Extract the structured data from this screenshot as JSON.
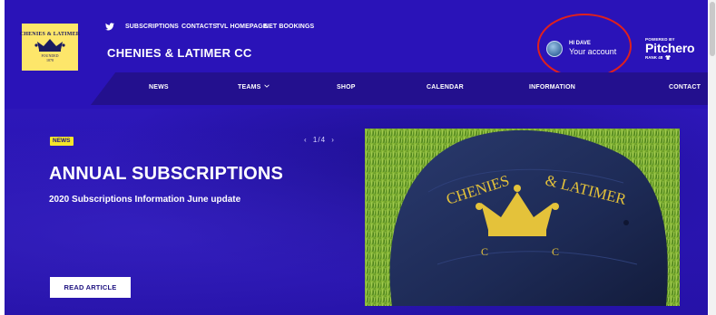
{
  "header": {
    "crest": {
      "name": "CHENIES & LATIMER",
      "founded": "FOUNDED",
      "year": "1878"
    },
    "top_links": [
      "SUBSCRIPTIONS",
      "CONTACTS",
      "TVL HOMEPAGE",
      "NET BOOKINGS"
    ],
    "club_name": "CHENIES & LATIMER CC",
    "account": {
      "greeting": "HI DAVE",
      "label": "Your account"
    },
    "pitchero": {
      "powered_by": "POWERED BY",
      "logo": "Pitchero",
      "rank": "RANK 48"
    }
  },
  "nav": {
    "items": [
      {
        "label": "NEWS"
      },
      {
        "label": "TEAMS",
        "has_dropdown": true
      },
      {
        "label": "SHOP"
      },
      {
        "label": "CALENDAR"
      },
      {
        "label": "INFORMATION"
      },
      {
        "label": "CONTACT"
      }
    ]
  },
  "hero": {
    "badge": "NEWS",
    "slider": {
      "prev": "‹",
      "position": "1/4",
      "next": "›"
    },
    "title": "ANNUAL SUBSCRIPTIONS",
    "subtitle": "2020 Subscriptions Information June update",
    "button": "READ ARTICLE",
    "photo": {
      "cap_text": "CHENIES & LATIMER",
      "cap_initials": "C  C"
    }
  },
  "colors": {
    "brand_blue": "#2a13b8",
    "nav_blue": "#23108e",
    "badge_yellow": "#f5e62a",
    "crest_yellow": "#fde66a",
    "highlight_red": "#e0201c",
    "cap_navy": "#1d2a55",
    "embroidery_gold": "#e4c23a"
  },
  "icons": {
    "social": "twitter-icon",
    "dropdown": "chevron-down-icon",
    "rank": "shirt-icon"
  }
}
